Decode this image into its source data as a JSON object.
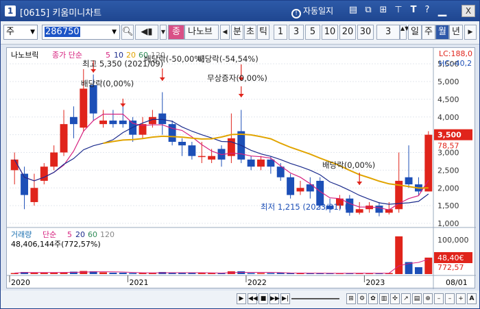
{
  "window": {
    "number": "1",
    "title": "[0615] 키움미니차트",
    "alarm_label": "자동일지",
    "toolbar_icons": [
      "layout-icon",
      "copy-icon",
      "grid-icon",
      "pin-icon",
      "text-icon",
      "help-icon"
    ],
    "close_label": "X"
  },
  "toolbar": {
    "market": "주",
    "code": "286750",
    "stock_type": "종",
    "stock_name": "나노브",
    "periods": [
      "분",
      "초",
      "틱"
    ],
    "intervals": [
      "1",
      "3",
      "5",
      "10",
      "20",
      "30"
    ],
    "count_value": "3",
    "period_tabs": [
      "일",
      "주",
      "월",
      "년"
    ],
    "active_tab": "월"
  },
  "chart": {
    "stock_label": "나노브릭",
    "ma_label": "종가 단순",
    "ma_periods": [
      "5",
      "10",
      "20",
      "60",
      "120"
    ],
    "high_label": "LC:188,0",
    "right_label": "HC:-40,2",
    "price_ticks": [
      "5,500",
      "5,000",
      "4,500",
      "4,000",
      "3,500",
      "3,000",
      "2,500",
      "2,000",
      "1,500",
      "1,000"
    ],
    "current_price": "3,500",
    "current_pct": "78,57",
    "annotations": {
      "max": "최고 5,350 (2021/09)",
      "rights_1": "배당락(-50,00%)",
      "div_1": "배당락(0,00%)",
      "div_2": "배당락(-54,54%)",
      "bonus": "무상증자(0,00%)",
      "div_3": "배당락(0,00%)",
      "min": "최저 1,215 (2023/01)"
    },
    "volume_label": "거래량",
    "volume_ma": "단순",
    "volume_periods": [
      "5",
      "20",
      "60",
      "120"
    ],
    "volume_total": "48,406,144주(772,57%)",
    "volume_ticks": [
      "100,000",
      "50,000"
    ],
    "volume_current": "48,40€",
    "volume_pct": "772,57",
    "years": [
      "2020",
      "2021",
      "2022",
      "2023"
    ],
    "last_date": "08/01",
    "colors": {
      "up": "#e0241b",
      "down": "#1c4fb7",
      "ma5": "#d6207e",
      "ma20": "#1a2a8c",
      "ma60": "#e1a400"
    }
  },
  "chart_data": {
    "type": "candlestick",
    "series": [
      {
        "name": "price",
        "values": [
          {
            "o": 2500,
            "c": 2800,
            "h": 3000,
            "l": 2100
          },
          {
            "o": 2400,
            "c": 1800,
            "h": 2600,
            "l": 1400
          },
          {
            "o": 1600,
            "c": 2000,
            "h": 2400,
            "l": 1500
          },
          {
            "o": 2200,
            "c": 2600,
            "h": 2700,
            "l": 2100
          },
          {
            "o": 2600,
            "c": 3000,
            "h": 3200,
            "l": 2500
          },
          {
            "o": 3000,
            "c": 3800,
            "h": 4200,
            "l": 2900
          },
          {
            "o": 4000,
            "c": 3800,
            "h": 4300,
            "l": 3400
          },
          {
            "o": 3700,
            "c": 4800,
            "h": 5350,
            "l": 3600
          },
          {
            "o": 4900,
            "c": 4100,
            "h": 5200,
            "l": 3900
          },
          {
            "o": 3800,
            "c": 3900,
            "h": 4200,
            "l": 3700
          },
          {
            "o": 3900,
            "c": 3800,
            "h": 4200,
            "l": 3700
          },
          {
            "o": 3900,
            "c": 3800,
            "h": 4300,
            "l": 3700
          },
          {
            "o": 3900,
            "c": 3500,
            "h": 4000,
            "l": 3300
          },
          {
            "o": 3500,
            "c": 3800,
            "h": 4000,
            "l": 3400
          },
          {
            "o": 3800,
            "c": 4000,
            "h": 4200,
            "l": 3700
          },
          {
            "o": 4100,
            "c": 3800,
            "h": 4700,
            "l": 3500
          },
          {
            "o": 3800,
            "c": 3300,
            "h": 3900,
            "l": 3200
          },
          {
            "o": 3300,
            "c": 3200,
            "h": 3400,
            "l": 2900
          },
          {
            "o": 3200,
            "c": 2900,
            "h": 3300,
            "l": 2800
          },
          {
            "o": 2900,
            "c": 2900,
            "h": 3300,
            "l": 2700
          },
          {
            "o": 2800,
            "c": 2900,
            "h": 3100,
            "l": 2700
          },
          {
            "o": 3100,
            "c": 2800,
            "h": 3200,
            "l": 2600
          },
          {
            "o": 2900,
            "c": 3400,
            "h": 4100,
            "l": 2700
          },
          {
            "o": 3600,
            "c": 2800,
            "h": 4200,
            "l": 2700
          },
          {
            "o": 2800,
            "c": 2600,
            "h": 2900,
            "l": 2500
          },
          {
            "o": 2600,
            "c": 2800,
            "h": 2900,
            "l": 2500
          },
          {
            "o": 2800,
            "c": 2600,
            "h": 2900,
            "l": 2400
          },
          {
            "o": 2600,
            "c": 2300,
            "h": 2700,
            "l": 2200
          },
          {
            "o": 2300,
            "c": 1800,
            "h": 2400,
            "l": 1700
          },
          {
            "o": 1900,
            "c": 2000,
            "h": 2200,
            "l": 1800
          },
          {
            "o": 2100,
            "c": 1900,
            "h": 2300,
            "l": 1700
          },
          {
            "o": 2200,
            "c": 1500,
            "h": 2300,
            "l": 1400
          },
          {
            "o": 1500,
            "c": 1400,
            "h": 1700,
            "l": 1300
          },
          {
            "o": 1500,
            "c": 1700,
            "h": 1800,
            "l": 1400
          },
          {
            "o": 1700,
            "c": 1300,
            "h": 1800,
            "l": 1215
          },
          {
            "o": 1300,
            "c": 1400,
            "h": 1600,
            "l": 1250
          },
          {
            "o": 1400,
            "c": 1500,
            "h": 1600,
            "l": 1300
          },
          {
            "o": 1500,
            "c": 1300,
            "h": 1600,
            "l": 1200
          },
          {
            "o": 1300,
            "c": 1400,
            "h": 1600,
            "l": 1250
          },
          {
            "o": 1400,
            "c": 2200,
            "h": 3000,
            "l": 1300
          },
          {
            "o": 2300,
            "c": 2100,
            "h": 3200,
            "l": 2000
          },
          {
            "o": 2100,
            "c": 1900,
            "h": 2300,
            "l": 1800
          },
          {
            "o": 1900,
            "c": 3500,
            "h": 3600,
            "l": 1900
          }
        ]
      },
      {
        "name": "volume",
        "values": [
          3,
          6,
          5,
          4,
          4,
          5,
          7,
          9,
          8,
          5,
          4,
          4,
          3,
          3,
          3,
          6,
          5,
          3,
          3,
          3,
          3,
          3,
          8,
          8,
          3,
          3,
          3,
          4,
          3,
          2,
          2,
          3,
          2,
          2,
          3,
          2,
          3,
          2,
          3,
          110,
          35,
          20,
          48
        ]
      }
    ],
    "ylim": [
      1000,
      5600
    ],
    "volume_ylim": [
      0,
      120
    ]
  }
}
